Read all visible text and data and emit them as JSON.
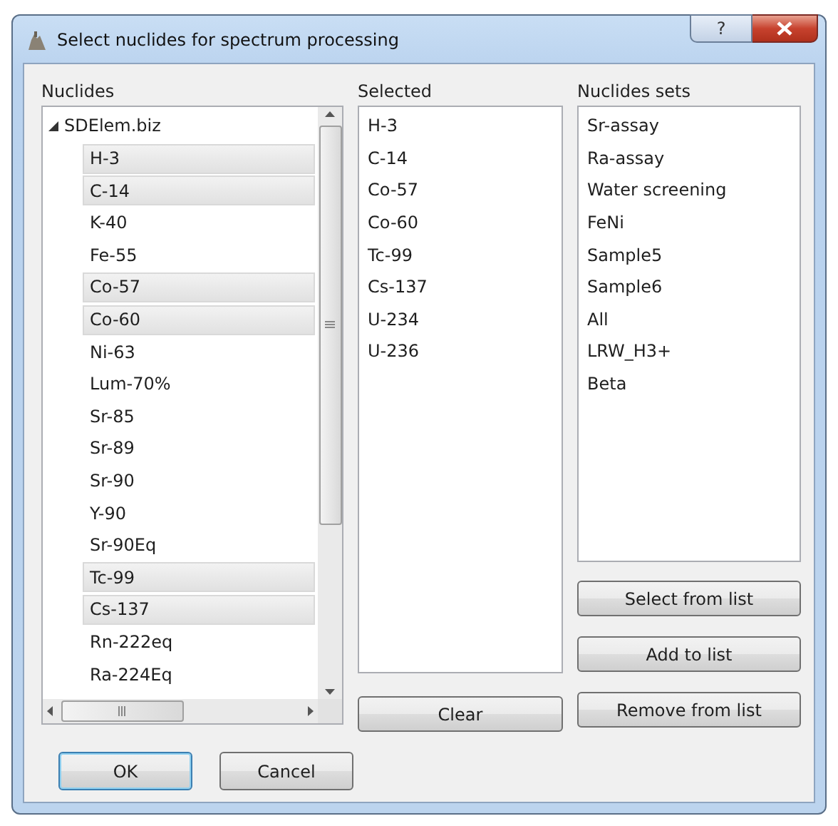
{
  "window": {
    "title": "Select nuclides for spectrum processing",
    "help_button": "?"
  },
  "nuclides": {
    "heading": "Nuclides",
    "root": {
      "label": "SDElem.biz",
      "expanded": true,
      "children": [
        {
          "label": "H-3",
          "selected": true
        },
        {
          "label": "C-14",
          "selected": true
        },
        {
          "label": "K-40",
          "selected": false
        },
        {
          "label": "Fe-55",
          "selected": false
        },
        {
          "label": "Co-57",
          "selected": true
        },
        {
          "label": "Co-60",
          "selected": true
        },
        {
          "label": "Ni-63",
          "selected": false
        },
        {
          "label": "Lum-70%",
          "selected": false
        },
        {
          "label": "Sr-85",
          "selected": false
        },
        {
          "label": "Sr-89",
          "selected": false
        },
        {
          "label": "Sr-90",
          "selected": false
        },
        {
          "label": "Y-90",
          "selected": false
        },
        {
          "label": "Sr-90Eq",
          "selected": false
        },
        {
          "label": "Tc-99",
          "selected": true
        },
        {
          "label": "Cs-137",
          "selected": true
        },
        {
          "label": "Rn-222eq",
          "selected": false
        },
        {
          "label": "Ra-224Eq",
          "selected": false
        }
      ]
    }
  },
  "selected": {
    "heading": "Selected",
    "items": [
      "H-3",
      "C-14",
      "Co-57",
      "Co-60",
      "Tc-99",
      "Cs-137",
      "U-234",
      "U-236"
    ],
    "clear_button": "Clear"
  },
  "nuclide_sets": {
    "heading": "Nuclides sets",
    "items": [
      "Sr-assay",
      "Ra-assay",
      "Water screening",
      "FeNi",
      "Sample5",
      "Sample6",
      "All",
      "LRW_H3+",
      "Beta"
    ],
    "buttons": [
      "Select from list",
      "Add to list",
      "Remove from list"
    ]
  },
  "buttons": [
    {
      "label": "OK",
      "default": true
    },
    {
      "label": "Cancel",
      "default": false
    }
  ]
}
